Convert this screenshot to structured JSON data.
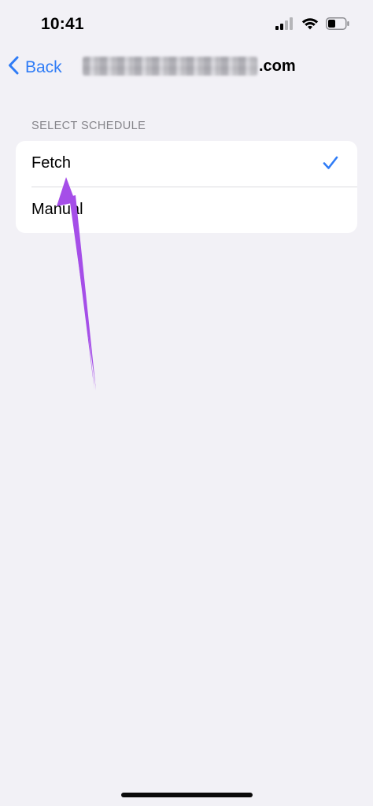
{
  "status_bar": {
    "time": "10:41",
    "icons": [
      "cellular-signal-icon",
      "wifi-icon",
      "battery-icon"
    ]
  },
  "nav": {
    "back_label": "Back",
    "title_suffix": ".com"
  },
  "schedule": {
    "section_header": "SELECT SCHEDULE",
    "options": [
      {
        "label": "Fetch",
        "selected": true
      },
      {
        "label": "Manual",
        "selected": false
      }
    ]
  },
  "colors": {
    "accent": "#2f7cf6",
    "background": "#f2f1f6",
    "annotation_arrow": "#a54ee8"
  }
}
